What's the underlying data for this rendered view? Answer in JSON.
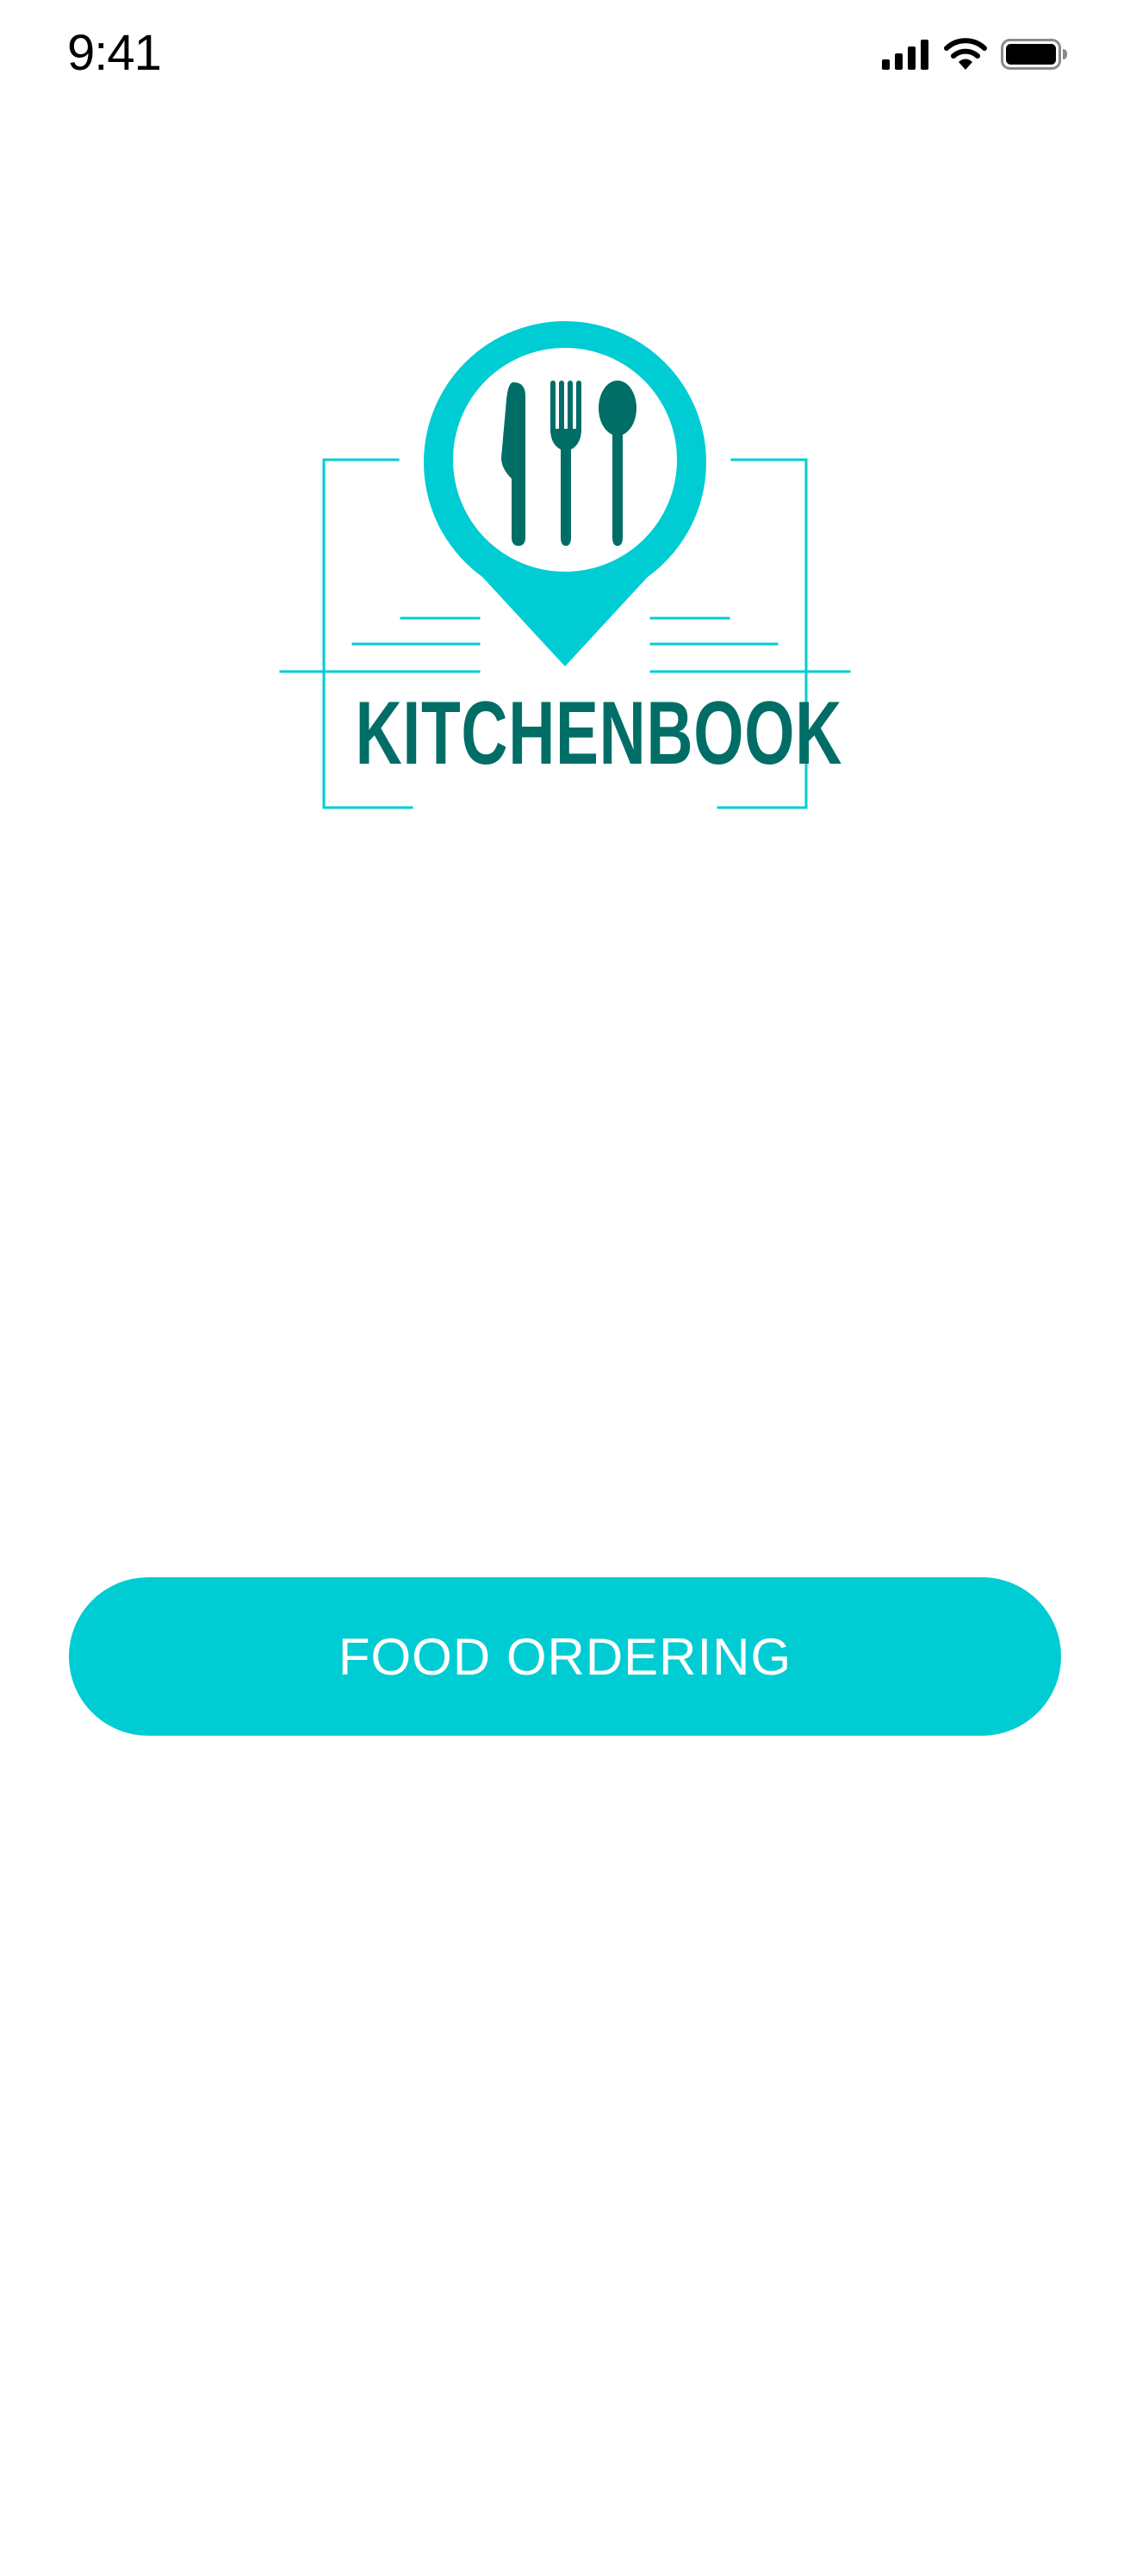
{
  "status_bar": {
    "time": "9:41",
    "icons": [
      "cellular-signal-icon",
      "wifi-icon",
      "battery-icon"
    ]
  },
  "logo": {
    "brand_name": "KITCHENBOOK",
    "icons": [
      "map-pin-icon",
      "knife-icon",
      "fork-icon",
      "spoon-icon"
    ]
  },
  "cta": {
    "label": "FOOD ORDERING"
  },
  "colors": {
    "accent": "#00ccd3",
    "brand_dark": "#006e66",
    "background": "#ffffff",
    "button_text": "#ffffff",
    "status_text": "#000000"
  }
}
